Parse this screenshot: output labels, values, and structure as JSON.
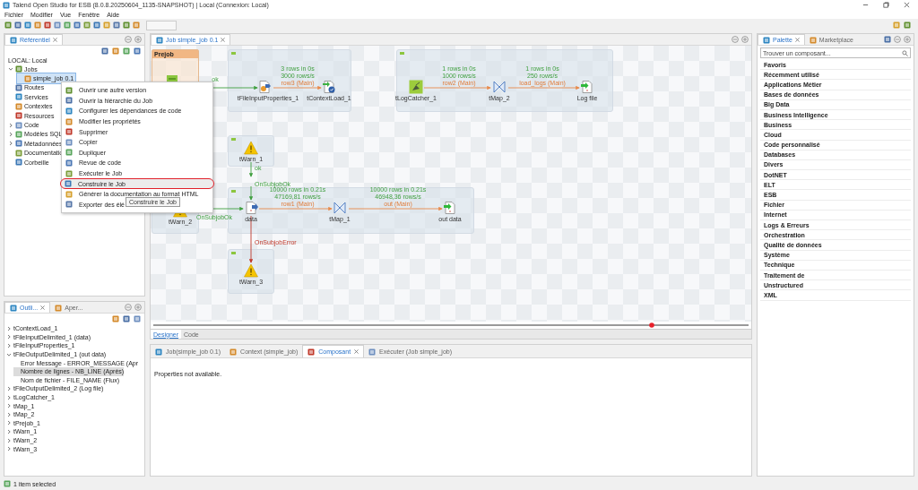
{
  "window": {
    "title": "Talend Open Studio for ESB (8.0.8.20250604_1135-SNAPSHOT) | Local (Connexion: Local)"
  },
  "menu_bar": [
    "Fichier",
    "Modifier",
    "Vue",
    "Fenêtre",
    "Aide"
  ],
  "repository": {
    "tab": {
      "label": "Référentiel",
      "selected": true
    },
    "root": "LOCAL: Local",
    "tree": [
      {
        "label": "Jobs",
        "expanded": true,
        "selected": false,
        "children": [
          {
            "label": "simple_job 0.1",
            "selected": true
          }
        ]
      },
      {
        "label": "Routes",
        "selected": false
      },
      {
        "label": "Services",
        "selected": false
      },
      {
        "label": "Contextes",
        "selected": false
      },
      {
        "label": "Resources",
        "selected": false
      },
      {
        "label": "Code",
        "expanded": false,
        "selected": false
      },
      {
        "label": "Modèles SQL",
        "expanded": false,
        "selected": false
      },
      {
        "label": "Métadonnées",
        "expanded": false,
        "selected": false
      },
      {
        "label": "Documentatio",
        "selected": false
      },
      {
        "label": "Corbeille",
        "selected": false
      }
    ]
  },
  "editor": {
    "tab": {
      "label": "Job simple_job 0.1",
      "selected": true
    },
    "canvas": {
      "prejob_title": "Prejob",
      "components": [
        {
          "kind": "prejob"
        },
        {
          "kind": "properties",
          "label": "tFileInputProperties_1"
        },
        {
          "kind": "context",
          "label": "tContextLoad_1"
        },
        {
          "kind": "logcatcher",
          "label": "tLogCatcher_1"
        },
        {
          "kind": "map",
          "label": "tMap_2"
        },
        {
          "kind": "fileout",
          "label": "Log file"
        },
        {
          "kind": "warn",
          "label": "tWarn_1"
        },
        {
          "kind": "filein",
          "label": "data"
        },
        {
          "kind": "map",
          "label": "tMap_1"
        },
        {
          "kind": "fileout",
          "label": "out data"
        },
        {
          "kind": "warn",
          "label": "tWarn_2"
        },
        {
          "kind": "warn",
          "label": "tWarn_3"
        }
      ],
      "links": [
        {
          "kind": "ok",
          "label": "ok"
        },
        {
          "kind": "main",
          "stats": [
            "3 rows in 0s",
            "3000 rows/s"
          ],
          "label": "row3 (Main)"
        },
        {
          "kind": "main",
          "stats": [
            "1 rows in 0s",
            "1000 rows/s"
          ],
          "label": "row2 (Main)"
        },
        {
          "kind": "main",
          "stats": [
            "1 rows in 0s",
            "250 rows/s"
          ],
          "label": "load_logs (Main)"
        },
        {
          "kind": "ok",
          "label": "ok"
        },
        {
          "kind": "subjob_ok",
          "label": "OnSubjobOk"
        },
        {
          "kind": "subjob_ok",
          "label": "OnSubjobOk"
        },
        {
          "kind": "main",
          "stats": [
            "10000 rows in 0.21s",
            "47169,81 rows/s"
          ],
          "label": "row1 (Main)"
        },
        {
          "kind": "main",
          "stats": [
            "10000 rows in 0.21s",
            "46948,36 rows/s"
          ],
          "label": "out (Main)"
        },
        {
          "kind": "subjob_error",
          "label": "OnSubjobError"
        }
      ]
    },
    "view_tabs": [
      {
        "label": "Designer",
        "selected": true
      },
      {
        "label": "Code",
        "selected": false
      }
    ]
  },
  "context_menu": {
    "items": [
      {
        "label": "Ouvrir une autre version",
        "selected": false
      },
      {
        "label": "Ouvrir la hiérarchie du Job",
        "selected": false
      },
      {
        "label": "Configurer les dépendances de code",
        "selected": false
      },
      {
        "label": "Modifier les propriétés",
        "selected": false
      },
      {
        "label": "Supprimer",
        "selected": false
      },
      {
        "label": "Copier",
        "selected": false
      },
      {
        "label": "Dupliquer",
        "selected": false
      },
      {
        "label": "Revue de code",
        "selected": false
      },
      {
        "label": "Exécuter le Job",
        "selected": false
      },
      {
        "label": "Construire le Job",
        "selected": true
      },
      {
        "label": "Générer la documentation au format HTML",
        "selected": false
      },
      {
        "label": "Exporter des élé",
        "selected": false
      }
    ]
  },
  "tooltip": "Construire le Job",
  "outline": {
    "tabs": [
      {
        "label": "Outli...",
        "selected": true
      },
      {
        "label": "Aper...",
        "selected": false
      }
    ],
    "tree": [
      {
        "label": "tContextLoad_1",
        "expanded": false
      },
      {
        "label": "tFileInputDelimited_1 (data)",
        "expanded": false
      },
      {
        "label": "tFileInputProperties_1",
        "expanded": false
      },
      {
        "label": "tFileOutputDelimited_1 (out data)",
        "expanded": true,
        "children": [
          {
            "label": "Error Message - ERROR_MESSAGE (Apr",
            "selected": false
          },
          {
            "label": "Nombre de lignes - NB_LINE (Après)",
            "selected": true
          },
          {
            "label": "Nom de fichier - FILE_NAME (Flux)",
            "selected": false
          }
        ]
      },
      {
        "label": "tFileOutputDelimited_2 (Log file)",
        "expanded": false
      },
      {
        "label": "tLogCatcher_1",
        "expanded": false
      },
      {
        "label": "tMap_1",
        "expanded": false
      },
      {
        "label": "tMap_2",
        "expanded": false
      },
      {
        "label": "tPrejob_1",
        "expanded": false
      },
      {
        "label": "tWarn_1",
        "expanded": false
      },
      {
        "label": "tWarn_2",
        "expanded": false
      },
      {
        "label": "tWarn_3",
        "expanded": false
      }
    ]
  },
  "bottom_panel": {
    "tabs": [
      {
        "label": "Job(simple_job 0.1)",
        "selected": false
      },
      {
        "label": "Context (simple_job)",
        "selected": false
      },
      {
        "label": "Composant",
        "selected": true
      },
      {
        "label": "Exécuter (Job simple_job)",
        "selected": false
      }
    ],
    "message": "Properties not available."
  },
  "palette": {
    "tabs": [
      {
        "label": "Palette",
        "selected": true
      },
      {
        "label": "Marketplace",
        "selected": false
      }
    ],
    "search": {
      "placeholder": "Trouver un composant..."
    },
    "categories": [
      "Favoris",
      "Récemment utilisé",
      "Applications Métier",
      "Bases de données",
      "Big Data",
      "Business Intelligence",
      "Business",
      "Cloud",
      "Code personnalisé",
      "Databases",
      "Divers",
      "DotNET",
      "ELT",
      "ESB",
      "Fichier",
      "Internet",
      "Logs & Erreurs",
      "Orchestration",
      "Qualité de données",
      "Système",
      "Technique",
      "Traitement de",
      "Unstructured",
      "XML"
    ]
  },
  "status_bar": "1 item selected"
}
